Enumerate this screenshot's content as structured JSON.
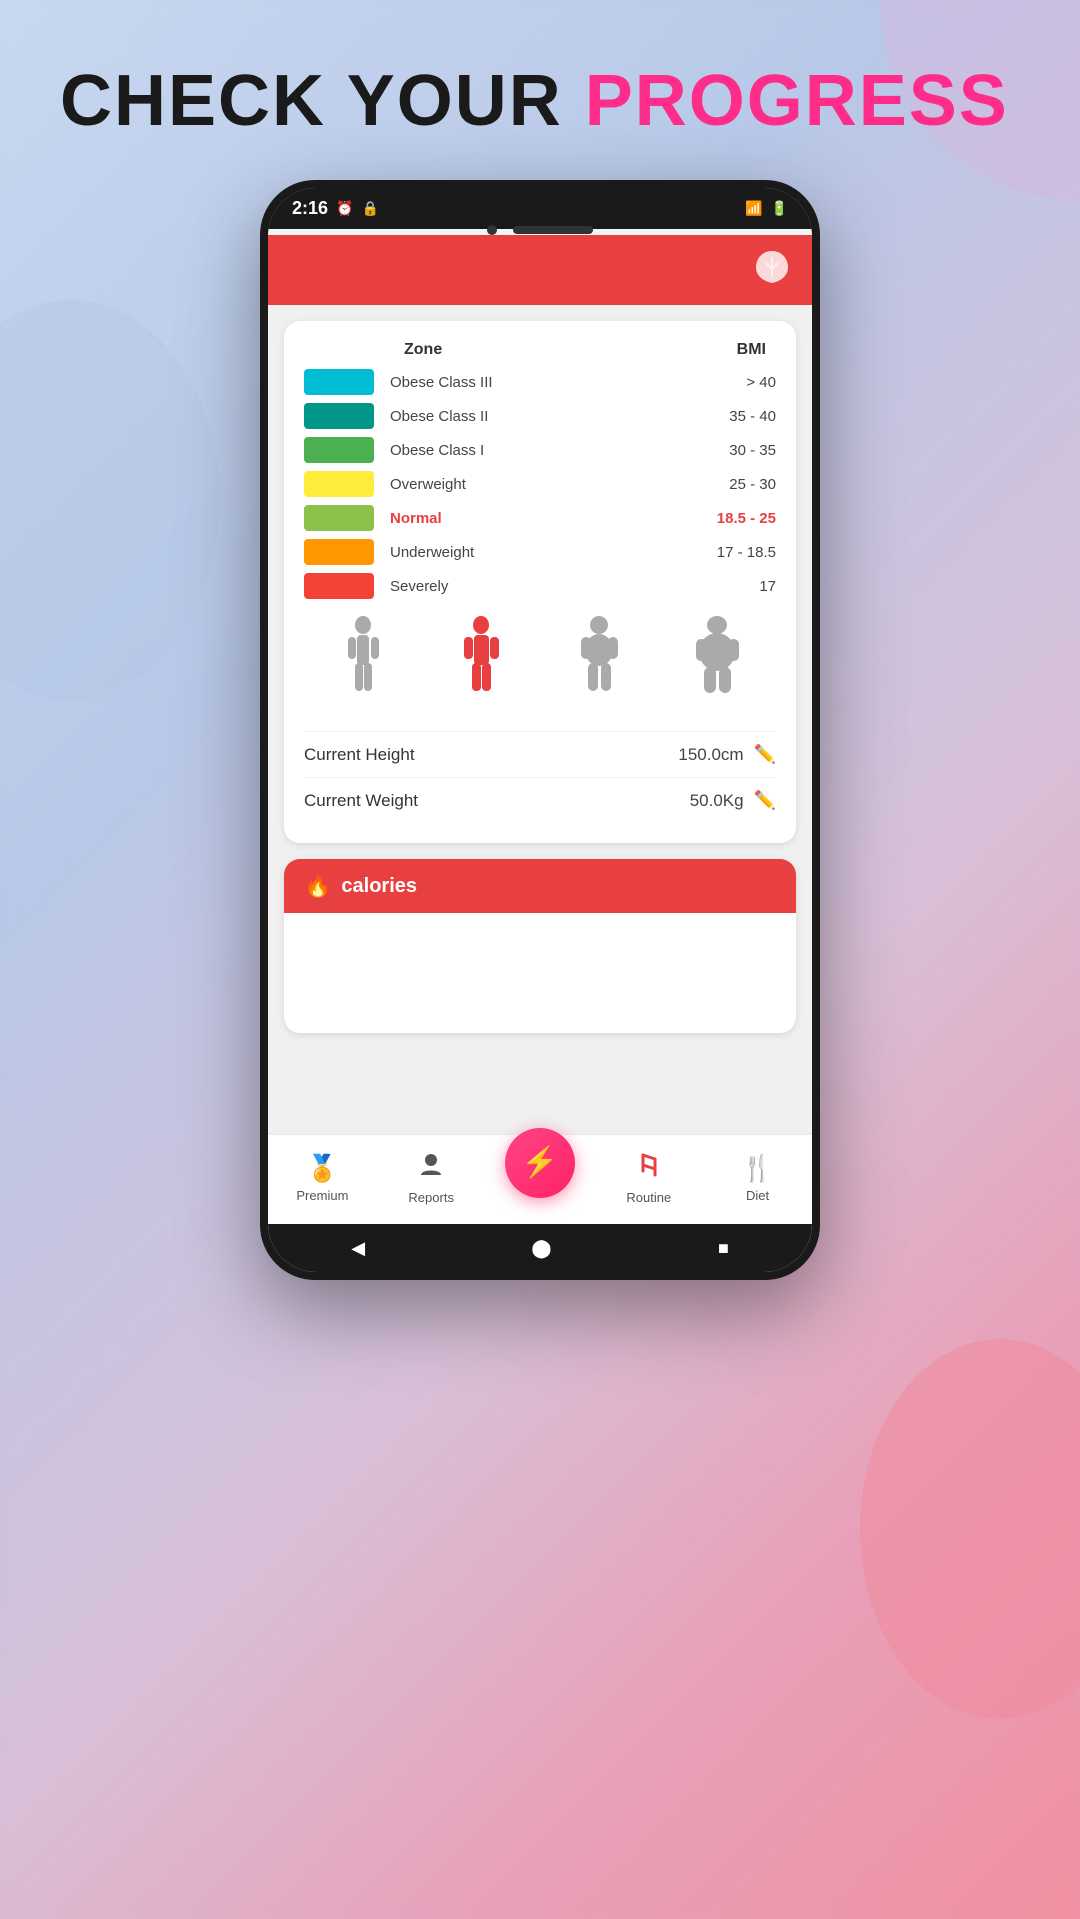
{
  "page": {
    "title_part1": "CHECK YOUR ",
    "title_part2": "PROGRESS"
  },
  "status_bar": {
    "time": "2:16",
    "icons": [
      "alarm",
      "lock",
      "signal",
      "battery"
    ]
  },
  "header": {
    "icon": "🍃"
  },
  "bmi_table": {
    "col_zone": "Zone",
    "col_bmi": "BMI",
    "rows": [
      {
        "color": "#00bcd4",
        "zone": "Obese Class III",
        "bmi": "> 40",
        "normal": false
      },
      {
        "color": "#009688",
        "zone": "Obese Class II",
        "bmi": "35 - 40",
        "normal": false
      },
      {
        "color": "#4caf50",
        "zone": "Obese Class I",
        "bmi": "30 - 35",
        "normal": false
      },
      {
        "color": "#ffeb3b",
        "zone": "Overweight",
        "bmi": "25 - 30",
        "normal": false
      },
      {
        "color": "#8bc34a",
        "zone": "Normal",
        "bmi": "18.5 - 25",
        "normal": true
      },
      {
        "color": "#ff9800",
        "zone": "Underweight",
        "bmi": "17 - 18.5",
        "normal": false
      },
      {
        "color": "#f44336",
        "zone": "Severely",
        "bmi": "17",
        "normal": false
      }
    ]
  },
  "measurements": {
    "height_label": "Current Height",
    "height_value": "150.0cm",
    "weight_label": "Current Weight",
    "weight_value": "50.0Kg"
  },
  "calories": {
    "title": "calories"
  },
  "bottom_nav": {
    "items": [
      {
        "id": "premium",
        "icon": "🏅",
        "label": "Premium"
      },
      {
        "id": "reports",
        "icon": "👤",
        "label": "Reports"
      },
      {
        "id": "fab",
        "icon": "⚡",
        "label": ""
      },
      {
        "id": "routine",
        "icon": "✂",
        "label": "Routine"
      },
      {
        "id": "diet",
        "icon": "🍴",
        "label": "Diet"
      }
    ]
  },
  "android_nav": {
    "back": "◀",
    "home": "⬤",
    "recent": "■"
  }
}
